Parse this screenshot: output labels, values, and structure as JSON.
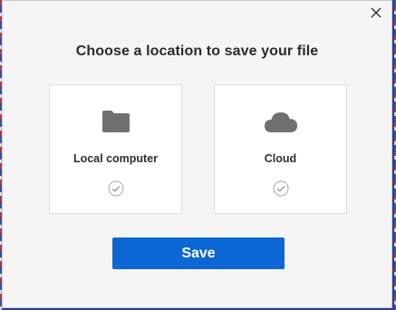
{
  "dialog": {
    "title": "Choose a location to save your file",
    "close_icon": "close-icon",
    "options": [
      {
        "label": "Local computer",
        "icon": "folder-icon",
        "selected": false
      },
      {
        "label": "Cloud",
        "icon": "cloud-icon",
        "selected": false
      }
    ],
    "save_label": "Save"
  },
  "colors": {
    "primary_button": "#0b67d4",
    "icon_gray": "#707070",
    "dialog_background": "#f5f5f5",
    "card_background": "#ffffff"
  }
}
